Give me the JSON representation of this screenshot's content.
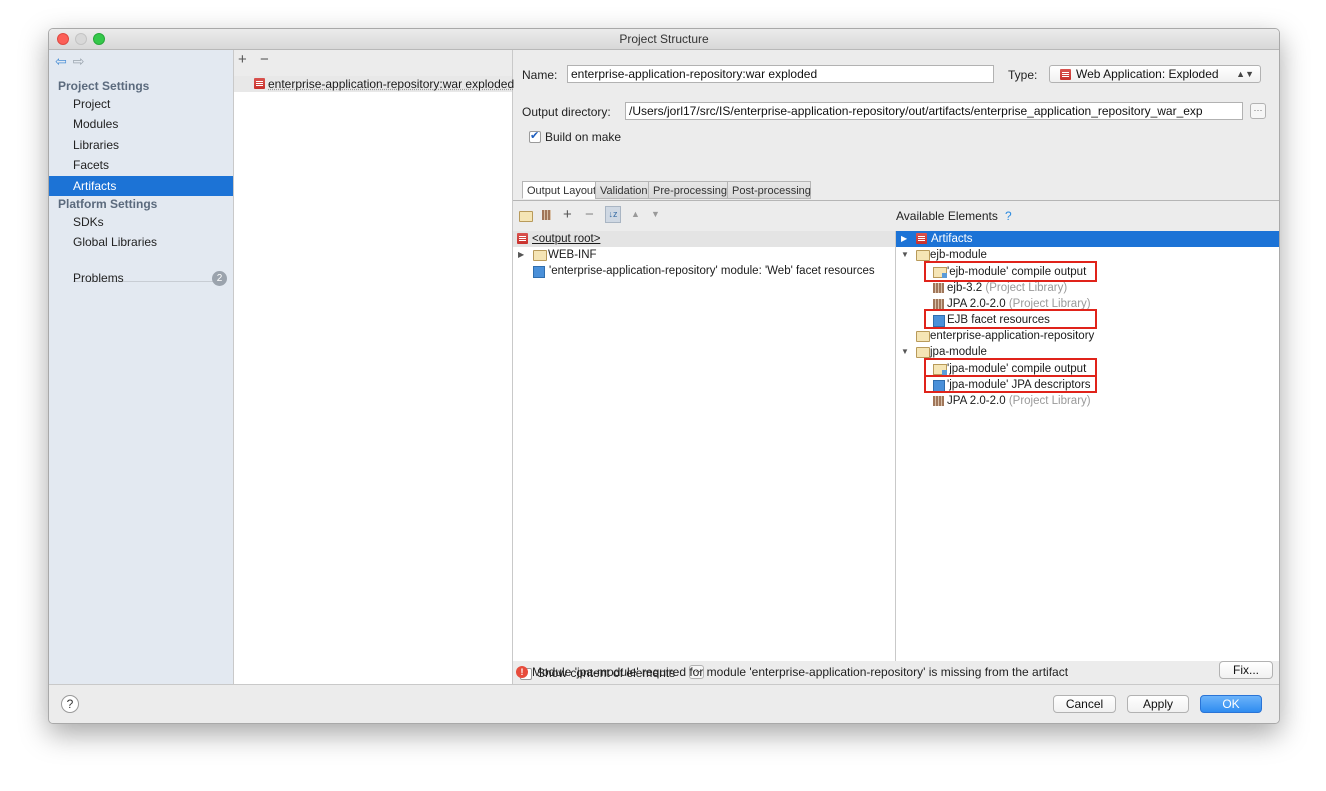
{
  "window": {
    "title": "Project Structure"
  },
  "sidebar": {
    "project_settings_header": "Project Settings",
    "items": [
      {
        "label": "Project"
      },
      {
        "label": "Modules"
      },
      {
        "label": "Libraries"
      },
      {
        "label": "Facets"
      },
      {
        "label": "Artifacts",
        "selected": true
      }
    ],
    "platform_settings_header": "Platform Settings",
    "platform_items": [
      {
        "label": "SDKs"
      },
      {
        "label": "Global Libraries"
      }
    ],
    "problems_label": "Problems",
    "problems_count": "2"
  },
  "artifact_list": {
    "add": "+",
    "remove": "−",
    "items": [
      {
        "label": "enterprise-application-repository:war exploded"
      }
    ]
  },
  "config": {
    "name_label": "Name:",
    "name_value": "enterprise-application-repository:war exploded",
    "type_label": "Type:",
    "type_value": "Web Application: Exploded",
    "output_dir_label": "Output directory:",
    "output_dir_value": "/Users/jorl17/src/IS/enterprise-application-repository/out/artifacts/enterprise_application_repository_war_exp",
    "build_on_make_label": "Build on make",
    "build_on_make": true
  },
  "tabs": [
    {
      "label": "Output Layout",
      "active": true
    },
    {
      "label": "Validation"
    },
    {
      "label": "Pre-processing"
    },
    {
      "label": "Post-processing"
    }
  ],
  "output_layout": {
    "rows": [
      {
        "label": "<output root>"
      },
      {
        "label": "WEB-INF"
      },
      {
        "label": "'enterprise-application-repository' module: 'Web' facet resources"
      }
    ]
  },
  "available": {
    "header": "Available Elements",
    "help": "?",
    "rows": [
      {
        "label": "Artifacts"
      },
      {
        "label": "ejb-module"
      },
      {
        "label": "'ejb-module' compile output"
      },
      {
        "label": "ejb-3.2",
        "suffix": "(Project Library)"
      },
      {
        "label": "JPA 2.0-2.0",
        "suffix": "(Project Library)"
      },
      {
        "label": "EJB facet resources"
      },
      {
        "label": "enterprise-application-repository"
      },
      {
        "label": "jpa-module"
      },
      {
        "label": "'jpa-module' compile output"
      },
      {
        "label": "'jpa-module' JPA descriptors"
      },
      {
        "label": "JPA 2.0-2.0",
        "suffix": "(Project Library)"
      }
    ]
  },
  "bottom": {
    "show_content_label": "Show content of elements",
    "error_message": "Module 'jpa-module' required for module 'enterprise-application-repository' is missing from the artifact",
    "fix_label": "Fix..."
  },
  "footer": {
    "help": "?",
    "cancel": "Cancel",
    "apply": "Apply",
    "ok": "OK"
  },
  "colors": {
    "selection": "#1c73d6",
    "highlight_box": "#e0231a",
    "ok_button": "#2f8cf0"
  }
}
